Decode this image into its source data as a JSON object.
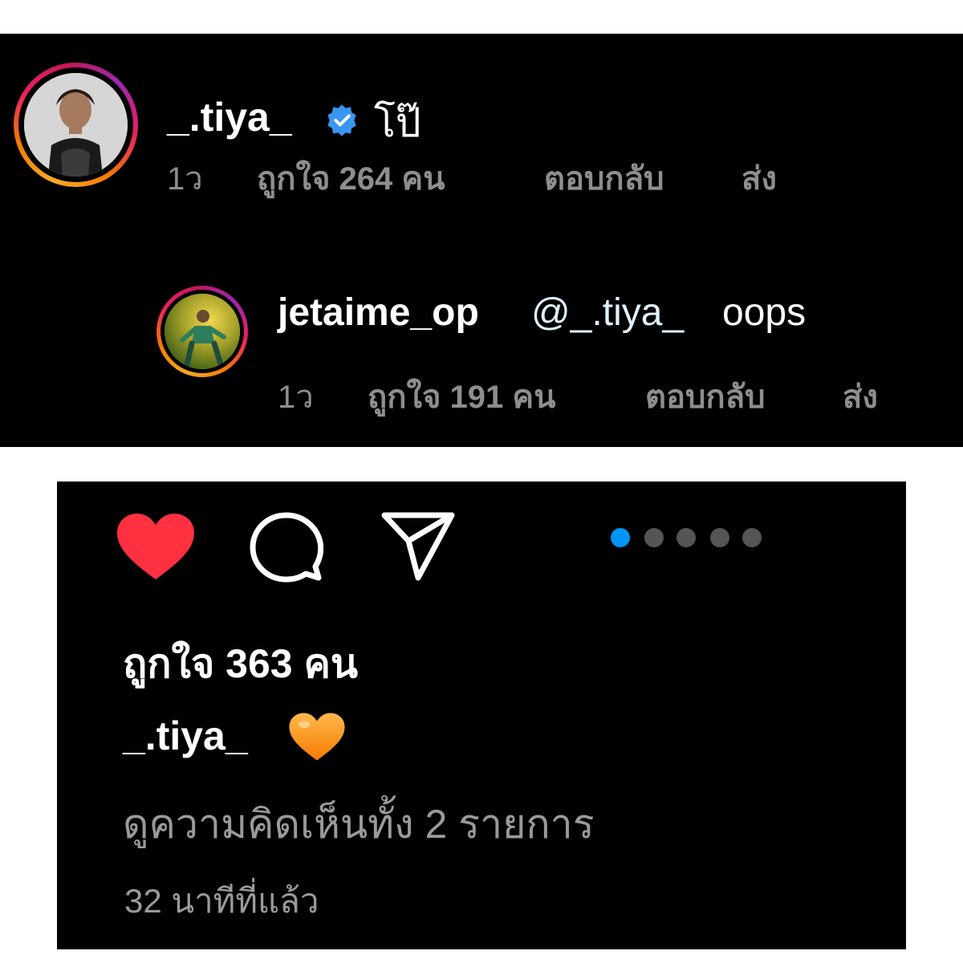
{
  "comment_1": {
    "username": "_.tiya_",
    "text": "โป๊",
    "time": "1ว",
    "likes": "ถูกใจ 264 คน",
    "reply_label": "ตอบกลับ",
    "send_label": "ส่ง"
  },
  "comment_2": {
    "username": "jetaime_op",
    "mention": "@_.tiya_",
    "text": "oops",
    "time": "1ว",
    "likes": "ถูกใจ 191 คน",
    "reply_label": "ตอบกลับ",
    "send_label": "ส่ง"
  },
  "post": {
    "like_count": "ถูกใจ 363 คน",
    "caption_username": "_.tiya_",
    "caption_emoji": "🧡",
    "view_comments": "ดูความคิดเห็นทั้ง 2 รายการ",
    "timestamp": "32 นาทีที่แล้ว",
    "carousel": {
      "total": 5,
      "active_index": 0
    }
  },
  "colors": {
    "like_red": "#ff3040",
    "verified_blue": "#3897f0",
    "active_dot": "#0095f6",
    "inactive_dot": "#555555",
    "meta_gray": "#8e8e8e"
  },
  "icons": [
    "heart-icon",
    "comment-icon",
    "share-icon",
    "verified-badge-icon",
    "orange-heart-emoji"
  ]
}
